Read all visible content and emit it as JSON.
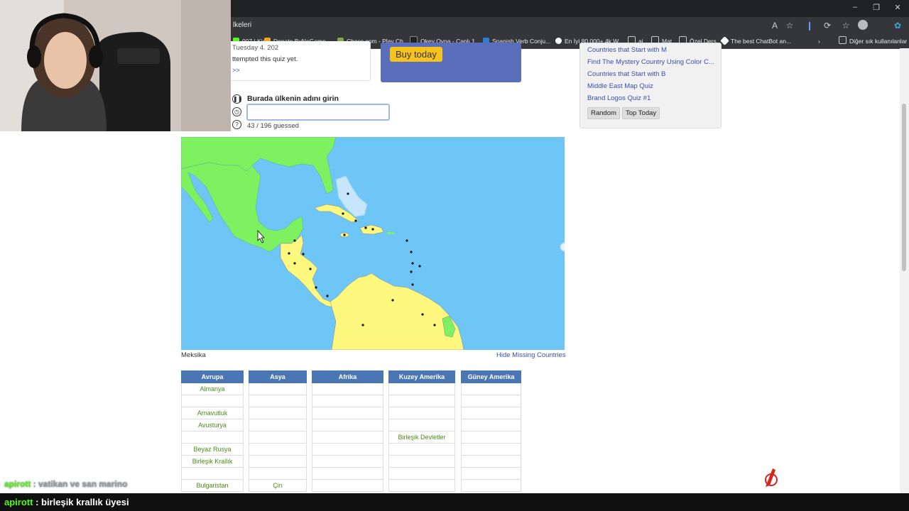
{
  "browser": {
    "tab_title_partial": "lkeleri",
    "bookmarks": [
      {
        "label": "007 | Kick",
        "color": "#53fc18"
      },
      {
        "label": "Donate ByNoGame...",
        "color": "#f5a623"
      },
      {
        "label": "Chess.com - Play Ch...",
        "color": "#7fa650"
      },
      {
        "label": "Okey Oyna - Canlı 1...",
        "color": "#222222"
      },
      {
        "label": "Spanish Verb Conju...",
        "color": "#2f7fd1"
      },
      {
        "label": "En İyi 80.000+ 4k W...",
        "color": "#ffffff"
      },
      {
        "label": "ai",
        "color": "#cccccc"
      },
      {
        "label": "Mat",
        "color": "#cccccc"
      },
      {
        "label": "Özel Ders",
        "color": "#cccccc"
      },
      {
        "label": "The best ChatBot an...",
        "color": "#ffffff"
      },
      {
        "label": "Diğer sık kullanılanlar",
        "color": "#cccccc"
      }
    ]
  },
  "top_card": {
    "line1_partial": "Tuesday 4. 202",
    "line2": "ttempted this quiz yet.",
    "more": ">>"
  },
  "premium": {
    "buy_label": "Buy today"
  },
  "sidebar": {
    "links": [
      "Countries that Start with M",
      "Find The Mystery Country Using Color C...",
      "Countries that Start with B",
      "Middle East Map Quiz",
      "Brand Logos Quiz #1"
    ],
    "random_label": "Random",
    "top_today_label": "Top Today"
  },
  "quiz": {
    "entry_label": "Burada ülkenin adını girin",
    "input_value": "",
    "progress": "43 / 196 guessed",
    "guessed_count": 43,
    "total_count": 196
  },
  "map": {
    "hover_label": "Meksika",
    "hide_missing": "Hide Missing Countries",
    "colors": {
      "ocean": "#6ec6f6",
      "guessed": "#7ef160",
      "unguessed": "#fff87f"
    }
  },
  "table": {
    "columns": [
      {
        "header": "Avrupa",
        "cells": [
          "Almanya",
          "",
          "Arnavutluk",
          "Avusturya",
          "",
          "Beyaz Rusya",
          "Birleşik Krallık",
          "",
          "Bulgaristan"
        ]
      },
      {
        "header": "Asya",
        "cells": [
          "",
          "",
          "",
          "",
          "",
          "",
          "",
          "",
          "Çin"
        ]
      },
      {
        "header": "Afrika",
        "cells": [
          "",
          "",
          "",
          "",
          "",
          "",
          "",
          "",
          ""
        ]
      },
      {
        "header": "Kuzey Amerika",
        "cells": [
          "",
          "",
          "",
          "",
          "Birleşik Devletler",
          "",
          "",
          "",
          ""
        ]
      },
      {
        "header": "Güney Amerika",
        "cells": [
          "",
          "",
          "",
          "",
          "",
          "",
          "",
          "",
          ""
        ]
      }
    ]
  },
  "chat": {
    "faded_user": "apirott",
    "faded_msg": " : vatikan ve san marino",
    "user": "apirott",
    "msg": " : birleşik krallık üyesi",
    "user_color": "#53fc18"
  }
}
